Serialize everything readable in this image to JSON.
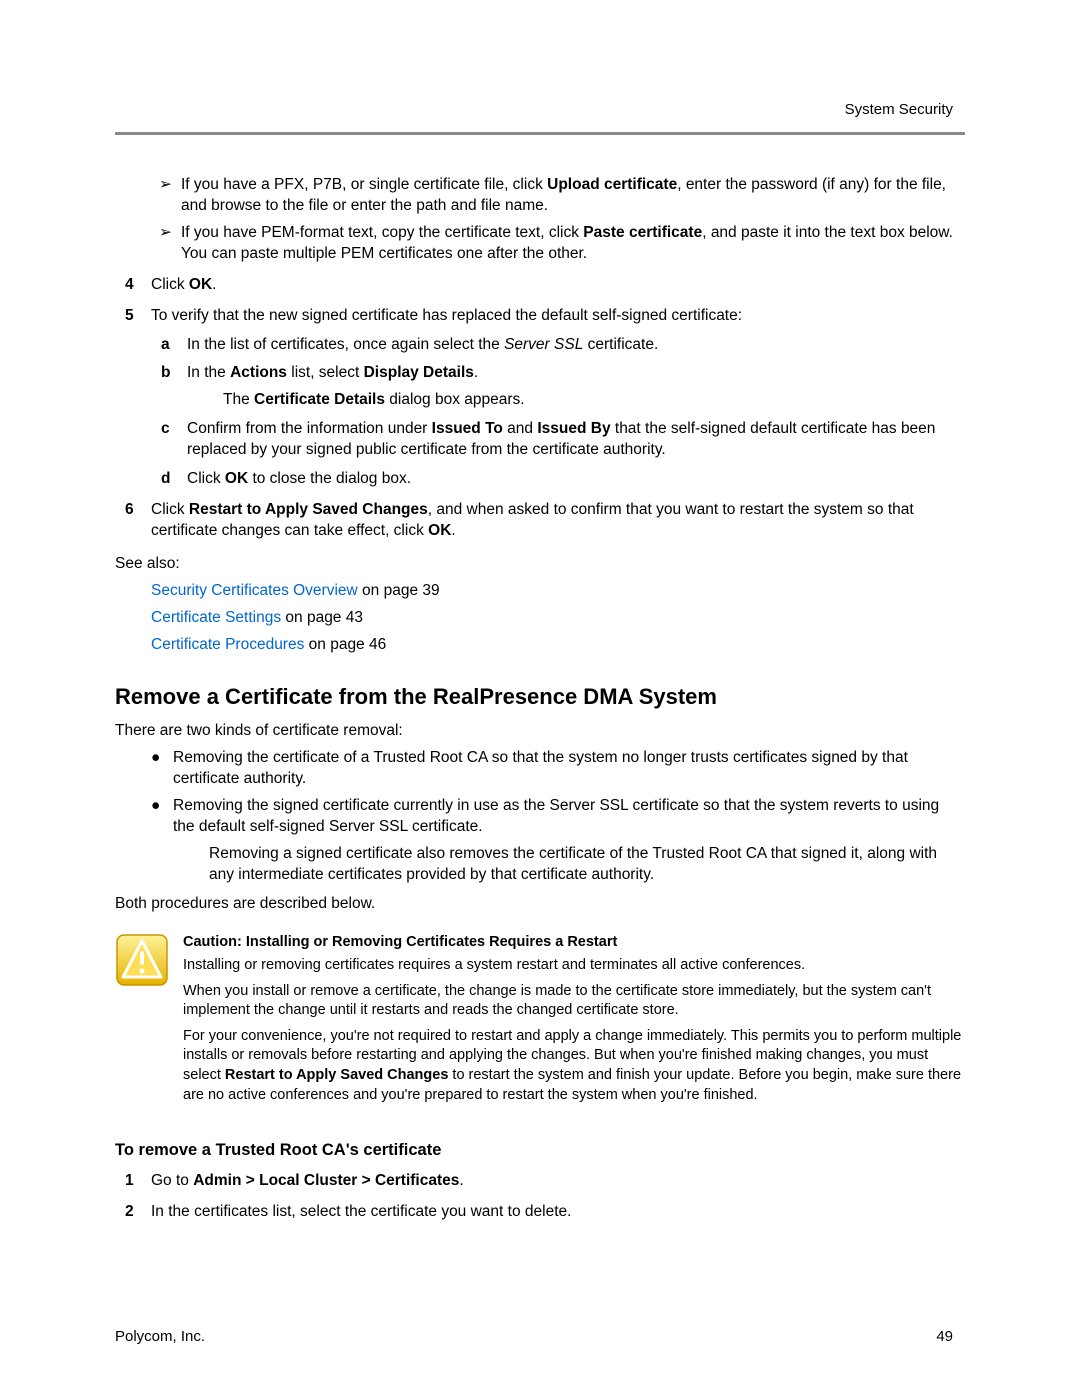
{
  "header": {
    "section": "System Security"
  },
  "footer": {
    "company": "Polycom, Inc.",
    "page": "49"
  },
  "arrows": [
    {
      "pre": "If you have a PFX, P7B, or single certificate file, click ",
      "bold1": "Upload certificate",
      "post": ", enter the password (if any) for the file, and browse to the file or enter the path and file name."
    },
    {
      "pre": "If you have PEM-format text, copy the certificate text, click ",
      "bold1": "Paste certificate",
      "post": ", and paste it into the text box below. You can paste multiple PEM certificates one after the other."
    }
  ],
  "step4": {
    "n": "4",
    "pre": "Click ",
    "bold": "OK",
    "post": "."
  },
  "step5": {
    "n": "5",
    "text": "To verify that the new signed certificate has replaced the default self-signed certificate:"
  },
  "sub5": {
    "a": {
      "m": "a",
      "pre": "In the list of certificates, once again select the ",
      "it": "Server SSL",
      "post": " certificate."
    },
    "b": {
      "m": "b",
      "pre": "In the ",
      "b1": "Actions",
      "mid1": " list, select ",
      "b2": "Display Details",
      "post": ".",
      "extra_pre": "The ",
      "extra_b": "Certificate Details",
      "extra_post": " dialog box appears."
    },
    "c": {
      "m": "c",
      "pre": "Confirm from the information under ",
      "b1": "Issued To",
      "mid1": " and ",
      "b2": "Issued By",
      "post": " that the self-signed default certificate has been replaced by your signed public certificate from the certificate authority."
    },
    "d": {
      "m": "d",
      "pre": "Click ",
      "b1": "OK",
      "post": " to close the dialog box."
    }
  },
  "step6": {
    "n": "6",
    "pre": "Click ",
    "b1": "Restart to Apply Saved Changes",
    "mid": ", and when asked to confirm that you want to restart the system so that certificate changes can take effect, click ",
    "b2": "OK",
    "post": "."
  },
  "seeAlso": "See also:",
  "links": [
    {
      "link": "Security Certificates Overview",
      "rest": " on page 39"
    },
    {
      "link": "Certificate Settings",
      "rest": " on page 43"
    },
    {
      "link": "Certificate Procedures",
      "rest": " on page 46"
    }
  ],
  "heading": "Remove a Certificate from the RealPresence DMA System",
  "intro": "There are two kinds of certificate removal:",
  "bullets": [
    {
      "text": "Removing the certificate of a Trusted Root CA so that the system no longer trusts certificates signed by that certificate authority."
    },
    {
      "text": "Removing the signed certificate currently in use as the Server SSL certificate so that the system reverts to using the default self-signed Server SSL certificate.",
      "extra": "Removing a signed certificate also removes the certificate of the Trusted Root CA that signed it, along with any intermediate certificates provided by that certificate authority."
    }
  ],
  "both": "Both procedures are described below.",
  "caution": {
    "title": "Caution: Installing or Removing Certificates Requires a Restart",
    "p1": "Installing or removing certificates requires a system restart and terminates all active conferences.",
    "p2": "When you install or remove a certificate, the change is made to the certificate store immediately, but the system can't implement the change until it restarts and reads the changed certificate store.",
    "p3_pre": "For your convenience, you're not required to restart and apply a change immediately. This permits you to perform multiple installs or removals before restarting and applying the changes. But when you're finished making changes, you must select ",
    "p3_bold": "Restart to Apply Saved Changes",
    "p3_post": " to restart the system and finish your update. Before you begin, make sure there are no active conferences and you're prepared to restart the system when you're finished."
  },
  "subheading": "To remove a Trusted Root CA's certificate",
  "proc": {
    "s1": {
      "n": "1",
      "pre": "Go to ",
      "b": "Admin > Local Cluster > Certificates",
      "post": "."
    },
    "s2": {
      "n": "2",
      "text": "In the certificates list, select the certificate you want to delete."
    }
  }
}
